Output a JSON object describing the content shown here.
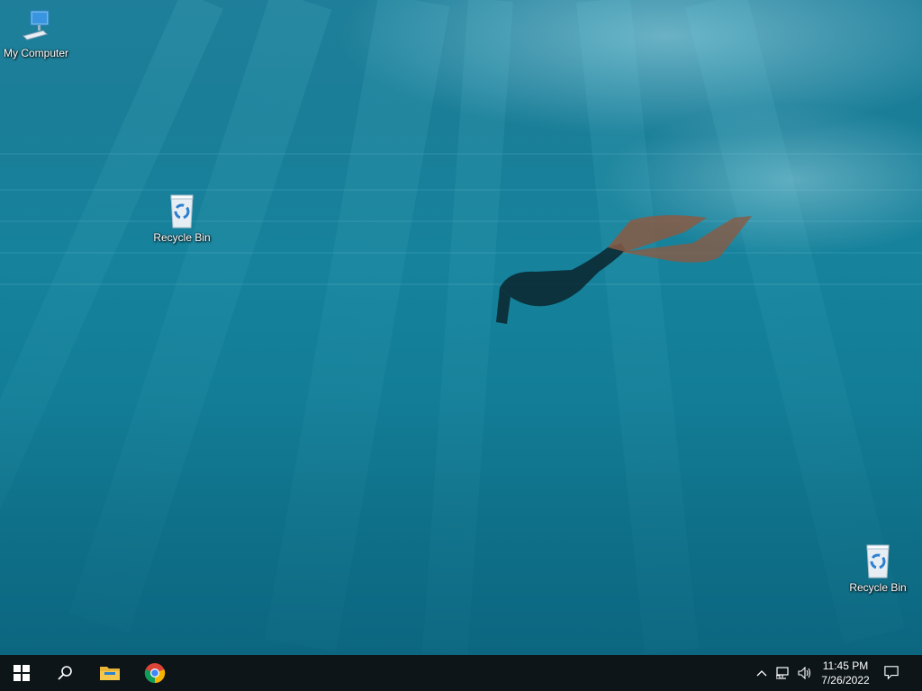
{
  "desktop": {
    "icons": [
      {
        "label": "My Computer",
        "icon": "computer-icon"
      },
      {
        "label": "Recycle Bin",
        "icon": "recycle-bin-icon"
      },
      {
        "label": "Recycle Bin",
        "icon": "recycle-bin-icon"
      }
    ]
  },
  "taskbar": {
    "start_icon": "windows-start-icon",
    "search_icon": "search-icon",
    "pinned": [
      {
        "icon": "file-explorer-icon"
      },
      {
        "icon": "chrome-icon"
      }
    ],
    "tray": {
      "icons": [
        "chevron-up-icon",
        "network-icon",
        "volume-icon"
      ],
      "time": "11:45 PM",
      "date": "7/26/2022",
      "notification_icon": "notification-icon"
    }
  }
}
